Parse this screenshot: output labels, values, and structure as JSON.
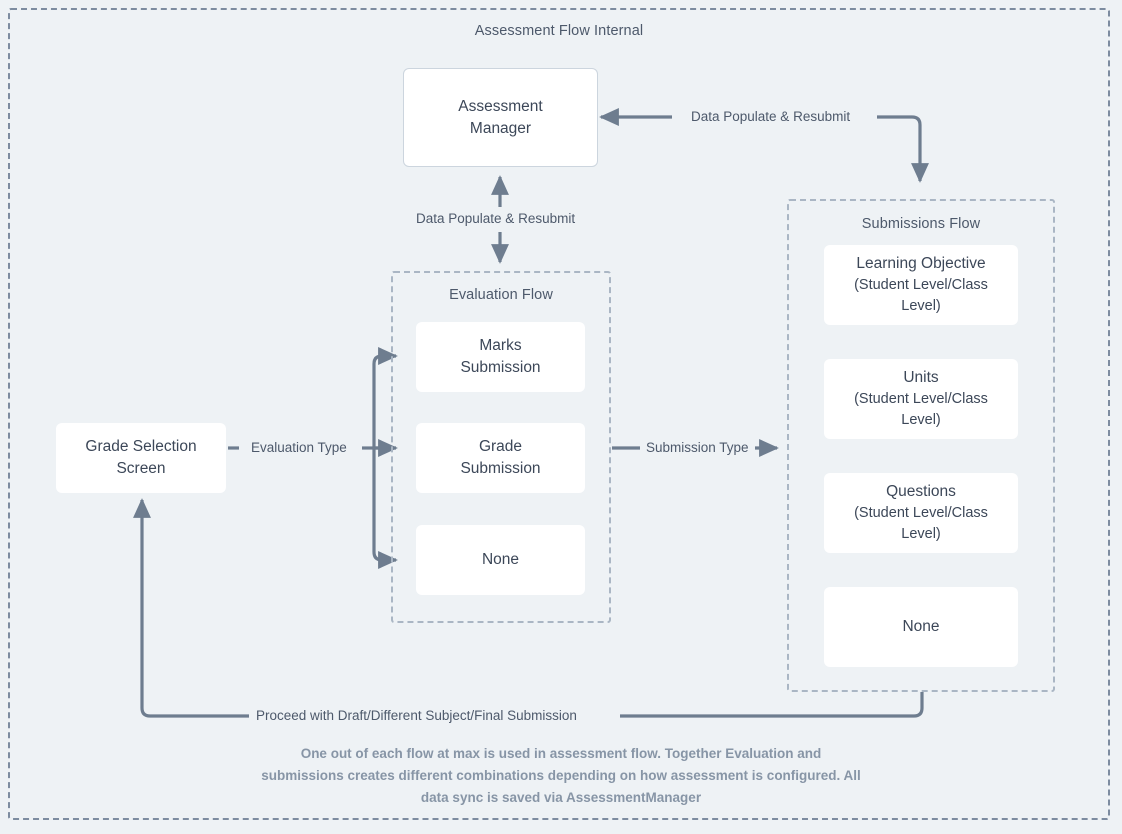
{
  "diagram": {
    "title": "Assessment Flow Internal",
    "caption": "One out of each flow at max is used in assessment flow. Together Evaluation and submissions creates different combinations depending on how assessment is configured. All data sync is saved via AssessmentManager",
    "colors": {
      "background": "#eef2f5",
      "outer_border": "#7d8ca0",
      "group_border": "#aab6c4",
      "node_fill": "#ffffff",
      "node_border": "#ccd5de",
      "connector": "#6e7d8f",
      "text": "#3c4758",
      "muted_text": "#8795a6"
    }
  },
  "nodes": {
    "assessment_manager": {
      "line1": "Assessment",
      "line2": "Manager"
    },
    "grade_selection": {
      "line1": "Grade Selection",
      "line2": "Screen"
    }
  },
  "evaluation_flow": {
    "title": "Evaluation Flow",
    "items": [
      {
        "line1": "Marks",
        "line2": "Submission"
      },
      {
        "line1": "Grade",
        "line2": "Submission"
      },
      {
        "line1": "None",
        "line2": ""
      }
    ]
  },
  "submissions_flow": {
    "title": "Submissions Flow",
    "items": [
      {
        "line1": "Learning Objective",
        "line2": "(Student Level/Class",
        "line3": "Level)"
      },
      {
        "line1": "Units",
        "line2": "(Student Level/Class",
        "line3": "Level)"
      },
      {
        "line1": "Questions",
        "line2": "(Student Level/Class",
        "line3": "Level)"
      },
      {
        "line1": "None",
        "line2": "",
        "line3": ""
      }
    ]
  },
  "edges": {
    "manager_to_submissions": "Data Populate &  Resubmit",
    "manager_to_evaluation": "Data Populate &  Resubmit",
    "evaluation_type": "Evaluation Type",
    "submission_type": "Submission Type",
    "proceed": "Proceed with Draft/Different Subject/Final Submission"
  }
}
